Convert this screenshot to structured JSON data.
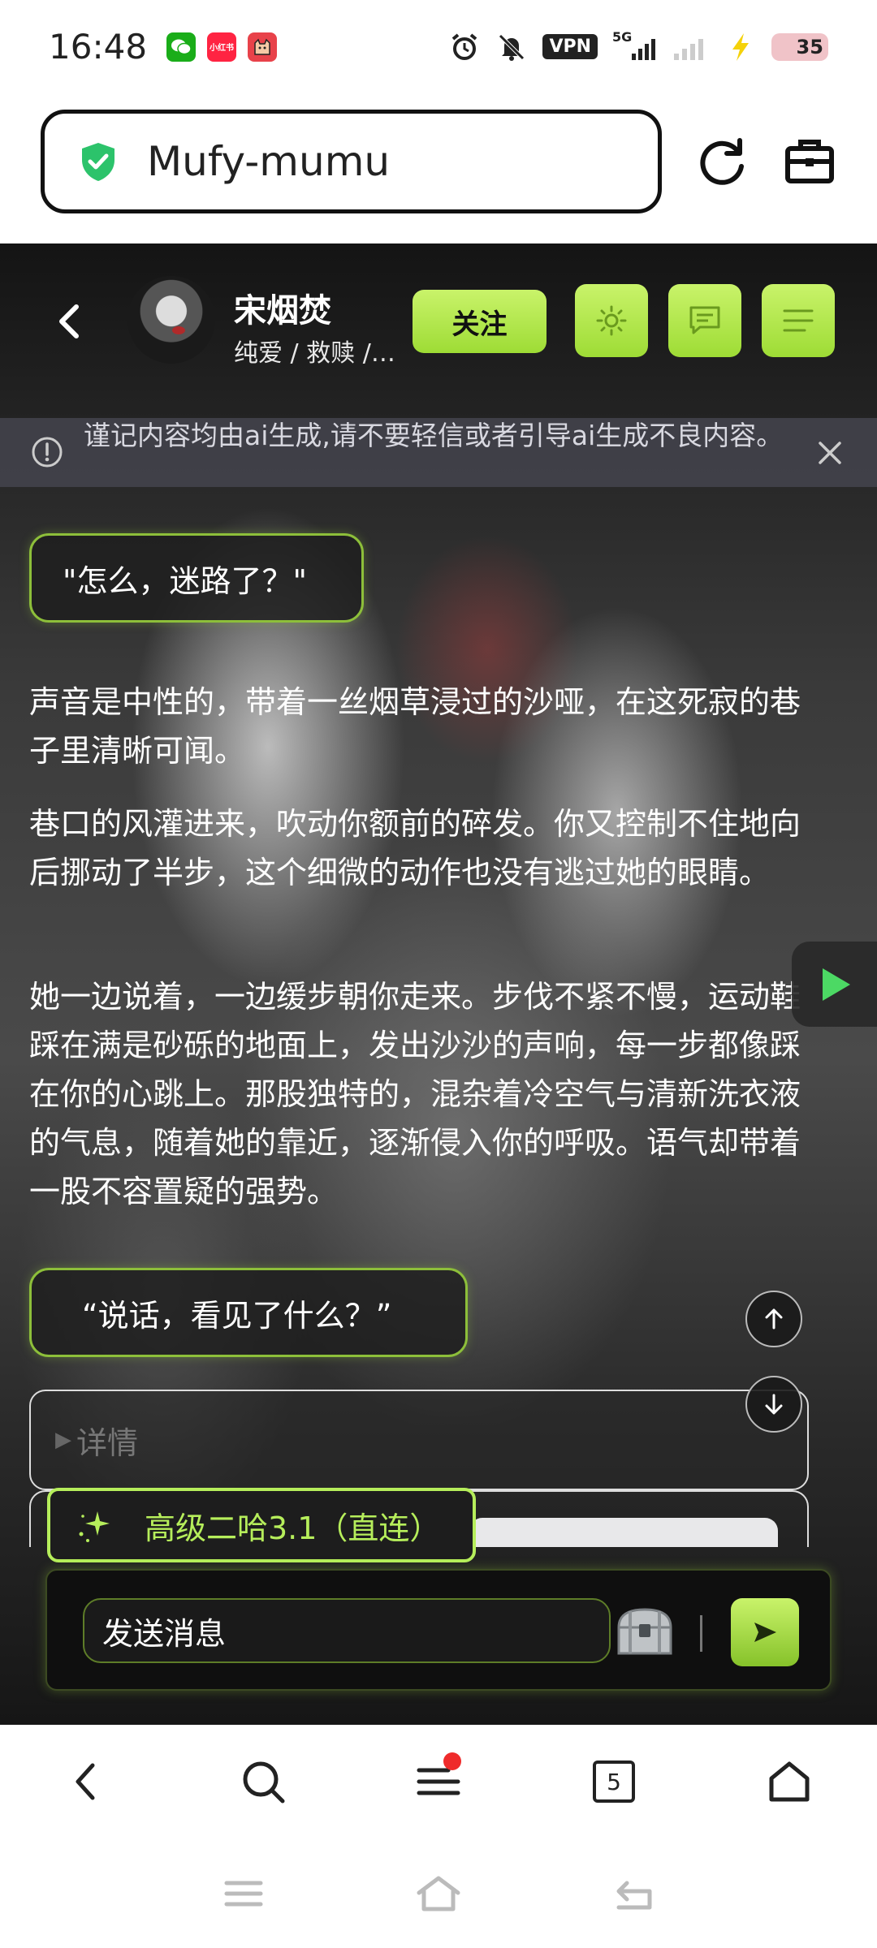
{
  "status_bar": {
    "time": "16:48",
    "apps": [
      {
        "name": "wechat-icon",
        "color": "#1aad19",
        "label": ""
      },
      {
        "name": "xiaohongshu-icon",
        "color": "#ff2442",
        "label": "小红书"
      },
      {
        "name": "cat-app-icon",
        "color": "#e8424a",
        "label": ""
      }
    ],
    "vpn": "VPN",
    "network": "5G",
    "battery": "35",
    "battery_level": 0.35
  },
  "browser": {
    "url": "Mufy-mumu"
  },
  "header": {
    "name": "宋烟焚",
    "tags": "纯爱 / 救赎 /…",
    "follow_label": "关注"
  },
  "notice": {
    "text": "谨记内容均由ai生成,请不要轻信或者引导ai生成不良内容。"
  },
  "messages": {
    "speech_1": "\"怎么，迷路了？\"",
    "narration_1": "声音是中性的，带着一丝烟草浸过的沙哑，在这死寂的巷子里清晰可闻。",
    "narration_2": "巷口的风灌进来，吹动你额前的碎发。你又控制不住地向后挪动了半步，这个细微的动作也没有逃过她的眼睛。",
    "narration_3": "她一边说着，一边缓步朝你走来。步伐不紧不慢，运动鞋踩在满是砂砾的地面上，发出沙沙的声响，每一步都像踩在你的心跳上。那股独特的，混杂着冷空气与清新洗衣液的气息，随着她的靠近，逐渐侵入你的呼吸。语气却带着一股不容置疑的强势。",
    "speech_2": "“说话，看见了什么？”"
  },
  "details": {
    "label": "详情"
  },
  "model": {
    "label": "高级二哈3.1（直连）"
  },
  "input": {
    "placeholder": "发送消息"
  },
  "browser_nav": {
    "tab_count": "5"
  },
  "colors": {
    "accent": "#b6ee5b",
    "accent_dark": "#9edc35",
    "notification_dot": "#ef2b2b"
  }
}
